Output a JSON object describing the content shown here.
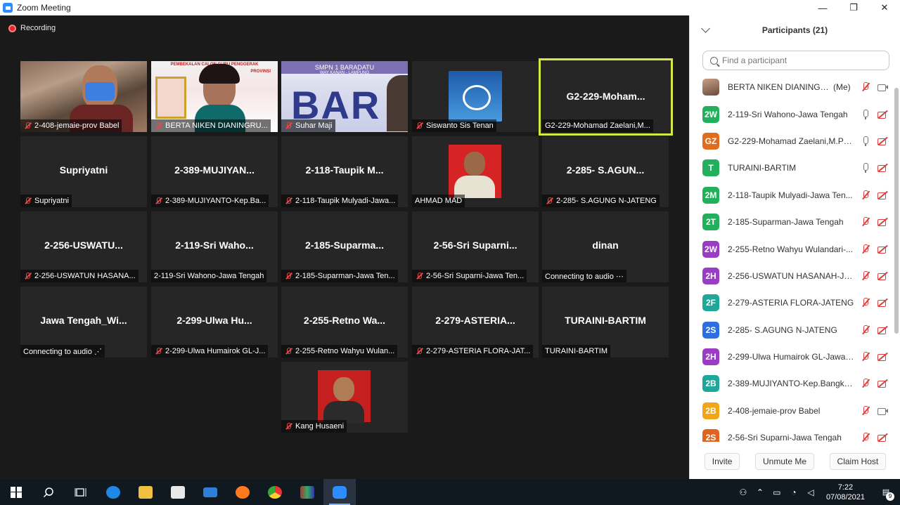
{
  "window": {
    "title": "Zoom Meeting",
    "controls": [
      "—",
      "❐",
      "✕"
    ]
  },
  "recording": {
    "label": "Recording"
  },
  "tiles": [
    {
      "label": "2-408-jemaie-prov Babel",
      "big": ""
    },
    {
      "label": "BERTA NIKEN DIANINGRU...",
      "big": ""
    },
    {
      "label": "Suhar Maji",
      "big": ""
    },
    {
      "label": "Siswanto Sis Tenan",
      "big": ""
    },
    {
      "label": "G2-229-Mohamad Zaelani,M...",
      "big": "G2-229-Moham..."
    },
    {
      "label": "Supriyatni",
      "big": "Supriyatni"
    },
    {
      "label": "2-389-MUJIYANTO-Kep.Ba...",
      "big": "2-389-MUJIYAN..."
    },
    {
      "label": "2-118-Taupik Mulyadi-Jawa...",
      "big": "2-118-Taupik  M..."
    },
    {
      "label": "AHMAD MAD",
      "big": ""
    },
    {
      "label": "2-285- S.AGUNG N-JATENG",
      "big": "2-285- S.AGUN..."
    },
    {
      "label": "2-256-USWATUN HASANA...",
      "big": "2-256-USWATU..."
    },
    {
      "label": "2-119-Sri Wahono-Jawa Tengah",
      "big": "2-119-Sri  Waho..."
    },
    {
      "label": "2-185-Suparman-Jawa Ten...",
      "big": "2-185-Suparma..."
    },
    {
      "label": "2-56-Sri Suparni-Jawa Ten...",
      "big": "2-56-Sri  Suparni..."
    },
    {
      "label": "Connecting to audio ⋯",
      "big": "dinan"
    },
    {
      "label": "Connecting to audio ⋰",
      "big": "Jawa  Tengah_Wi..."
    },
    {
      "label": "2-299-Ulwa Humairok GL-J...",
      "big": "2-299-Ulwa  Hu..."
    },
    {
      "label": "2-255-Retno Wahyu Wulan...",
      "big": "2-255-Retno  Wa..."
    },
    {
      "label": "2-279-ASTERIA FLORA-JAT...",
      "big": "2-279-ASTERIA..."
    },
    {
      "label": "TURAINI-BARTIM",
      "big": "TURAINI-BARTIM"
    },
    {
      "label": "Kang Husaeni",
      "big": ""
    }
  ],
  "tile_text": {
    "bar": "BAR",
    "banner": "SMPN 1 BARADATU",
    "banner_sub": "WAY KANAN - LAMPUNG",
    "sign": "PEMBEKALAN CALON GURU PENGGERAK",
    "sign_sub": "PROVINSI"
  },
  "panel": {
    "title": "Participants (21)",
    "search_placeholder": "Find a participant",
    "me_tag": "(Me)",
    "participants": [
      {
        "initials": "",
        "color": "#b0846c",
        "name": "BERTA NIKEN DIANINGRU..."
      },
      {
        "initials": "2W",
        "color": "#22b05c",
        "name": "2-119-Sri Wahono-Jawa Tengah"
      },
      {
        "initials": "GZ",
        "color": "#e06c1e",
        "name": "G2-229-Mohamad Zaelani,M.Pd..."
      },
      {
        "initials": "T",
        "color": "#22b05c",
        "name": "TURAINI-BARTIM"
      },
      {
        "initials": "2M",
        "color": "#22b05c",
        "name": "2-118-Taupik Mulyadi-Jawa Ten..."
      },
      {
        "initials": "2T",
        "color": "#22b05c",
        "name": "2-185-Suparman-Jawa Tengah"
      },
      {
        "initials": "2W",
        "color": "#9a3cc4",
        "name": "2-255-Retno Wahyu Wulandari-..."
      },
      {
        "initials": "2H",
        "color": "#9a3cc4",
        "name": "2-256-USWATUN HASANAH-JA..."
      },
      {
        "initials": "2F",
        "color": "#1fa89a",
        "name": "2-279-ASTERIA FLORA-JATENG"
      },
      {
        "initials": "2S",
        "color": "#2d6fe0",
        "name": "2-285- S.AGUNG N-JATENG"
      },
      {
        "initials": "2H",
        "color": "#9a3cc4",
        "name": "2-299-Ulwa Humairok GL-Jawa ..."
      },
      {
        "initials": "2B",
        "color": "#1fa89a",
        "name": "2-389-MUJIYANTO-Kep.Bangka ..."
      },
      {
        "initials": "2B",
        "color": "#f2a516",
        "name": "2-408-jemaie-prov Babel"
      },
      {
        "initials": "2S",
        "color": "#e0641e",
        "name": "2-56-Sri Suparni-Jawa Tengah"
      }
    ],
    "footer": {
      "invite": "Invite",
      "unmute": "Unmute Me",
      "claim": "Claim Host"
    }
  },
  "taskbar": {
    "time": "7:22",
    "date": "07/08/2021",
    "notif_count": "9"
  }
}
